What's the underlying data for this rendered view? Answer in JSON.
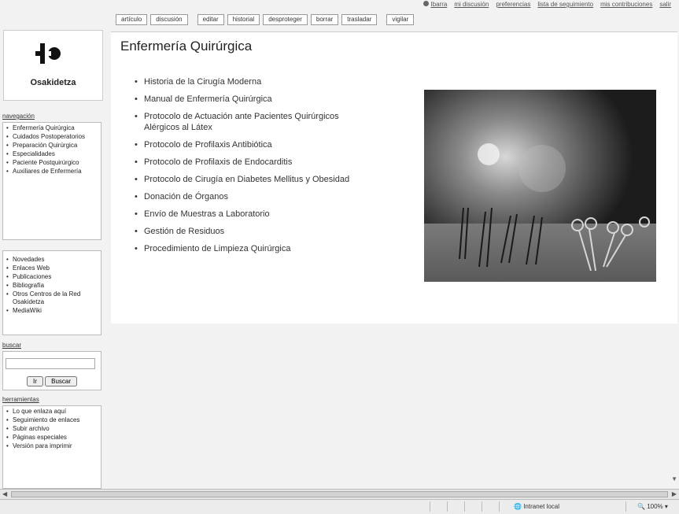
{
  "personal_bar": {
    "items": [
      "Ibarra",
      "mi discusión",
      "preferencias",
      "lista de seguimiento",
      "mis contribuciones",
      "salir"
    ]
  },
  "tabs": [
    "artículo",
    "discusión",
    "editar",
    "historial",
    "desproteger",
    "borrar",
    "trasladar",
    "vigilar"
  ],
  "logo": {
    "text": "Osakidetza"
  },
  "navigation": {
    "title": "navegación",
    "items": [
      "Enfermería Quirúrgica",
      "Cuidados Postoperatorios",
      "Preparación Quirúrgica",
      "Especialidades",
      "Paciente Postquirúrgico",
      "Auxiliares de Enfermería"
    ]
  },
  "resources": {
    "items": [
      "Novedades",
      "Enlaces Web",
      "Publicaciones",
      "Bibliografía",
      "Otros Centros de la Red Osakidetza",
      "MediaWiki"
    ]
  },
  "search": {
    "title": "buscar",
    "go_label": "Ir",
    "search_label": "Buscar",
    "value": ""
  },
  "toolbox": {
    "title": "herramientas",
    "items": [
      "Lo que enlaza aquí",
      "Seguimiento de enlaces",
      "Subir archivo",
      "Páginas especiales",
      "Versión para imprimir"
    ]
  },
  "article": {
    "title": "Enfermería Quirúrgica",
    "links": [
      "Historia de la Cirugía Moderna",
      "Manual de Enfermería Quirúrgica",
      "Protocolo de Actuación ante Pacientes Quirúrgicos Alérgicos al Látex",
      "Protocolo de Profilaxis Antibiótica",
      "Protocolo de Profilaxis de Endocarditis",
      "Protocolo de Cirugía en Diabetes Mellitus y Obesidad",
      "Donación de Órganos",
      "Envío de Muestras a Laboratorio",
      "Gestión de Residuos",
      "Procedimiento de Limpieza Quirúrgica"
    ]
  },
  "status_bar": {
    "zone": "Intranet local",
    "zoom": "100%"
  }
}
